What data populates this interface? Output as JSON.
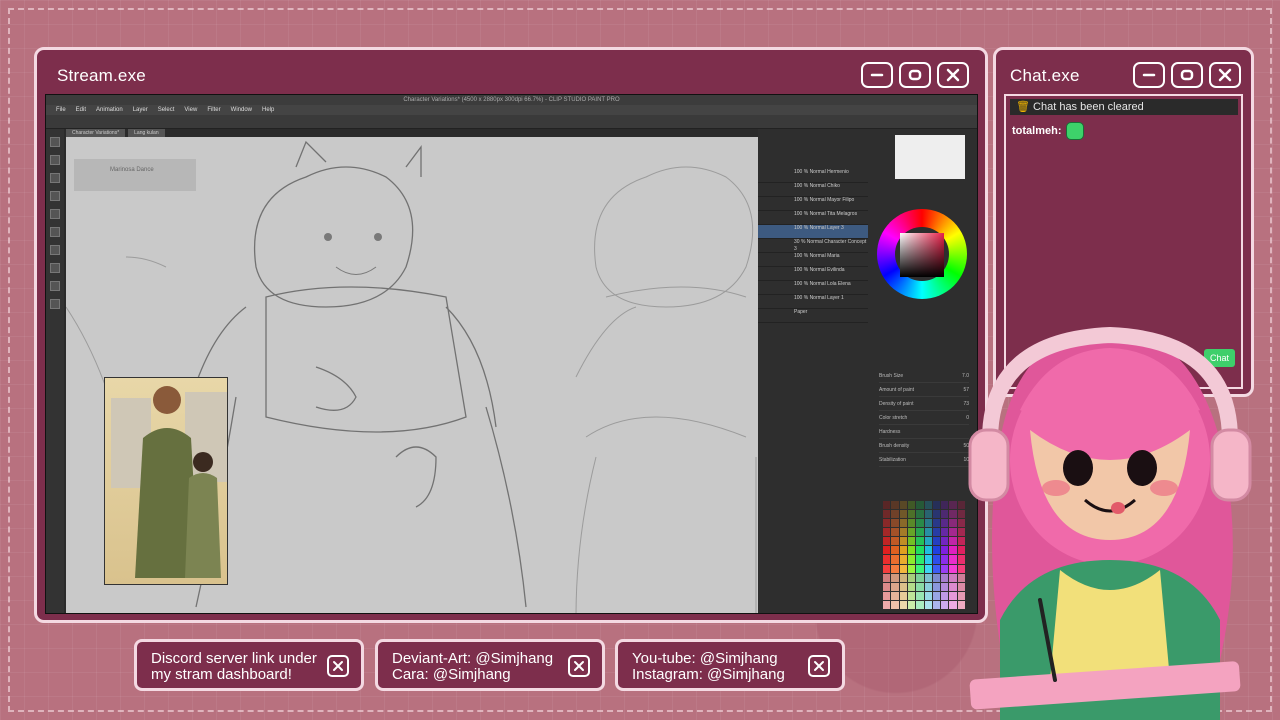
{
  "stream_window": {
    "title": "Stream.exe",
    "buttons": [
      "minimize",
      "maximize",
      "close"
    ]
  },
  "app": {
    "title": "Character Variations* (4500 x 2880px 300dpi 66.7%) - CLIP STUDIO PAINT PRO",
    "menu": [
      "File",
      "Edit",
      "Animation",
      "Layer",
      "Select",
      "View",
      "Filter",
      "Window",
      "Help"
    ],
    "tabs": [
      "Character Variations*",
      "Lang kulan"
    ],
    "sub_tool_label": "Marinosa Dance",
    "layers": [
      {
        "label": "100 % Normal Hermenio"
      },
      {
        "label": "100 % Normal Chiko"
      },
      {
        "label": "100 % Normal Mayor Filipo"
      },
      {
        "label": "100 % Normal Tita Melagros"
      },
      {
        "label": "100 % Normal Layer 3",
        "selected": true
      },
      {
        "label": "30 % Normal Character Concept 3"
      },
      {
        "label": "100 % Normal Maria"
      },
      {
        "label": "100 % Normal Evilinda"
      },
      {
        "label": "100 % Normal Lola Elena"
      },
      {
        "label": "100 % Normal Layer 1"
      },
      {
        "label": "Paper"
      }
    ],
    "tool_property": {
      "brush_size": "Brush Size",
      "brush_size_val": "7.0",
      "amount_of_paint": "Amount of paint",
      "amount_val": "57",
      "density_of_paint": "Density of paint",
      "density_val": "73",
      "color_stretch": "Color stretch",
      "color_stretch_val": "0",
      "hardness": "Hardness",
      "brush_density": "Brush density",
      "brush_density_val": "50",
      "stabilization": "Stabilization",
      "stabilization_val": "10"
    }
  },
  "chat_window": {
    "title": "Chat.exe",
    "notice": "Chat has been cleared",
    "messages": [
      {
        "user": "totalmeh:"
      }
    ],
    "send_label": "Chat"
  },
  "footer": {
    "cards": [
      {
        "line1": "Discord server link under",
        "line2": "my stram dashboard!"
      },
      {
        "line1": "Deviant-Art: @Simjhang",
        "line2": "Cara: @Simjhang"
      },
      {
        "line1": "You-tube: @Simjhang",
        "line2": "Instagram: @Simjhang"
      }
    ]
  },
  "colors": {
    "window_bg": "#7d2e4c",
    "window_border": "#f4d9e2",
    "page_bg": "#b8717f",
    "chat_accent": "#3ecf6b"
  }
}
